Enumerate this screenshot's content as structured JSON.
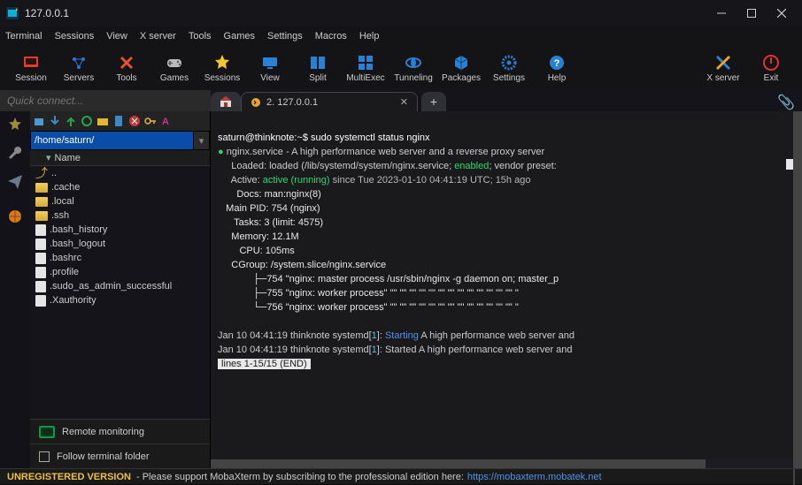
{
  "window": {
    "title": "127.0.0.1"
  },
  "menus": [
    "Terminal",
    "Sessions",
    "View",
    "X server",
    "Tools",
    "Games",
    "Settings",
    "Macros",
    "Help"
  ],
  "toolbar": [
    {
      "label": "Session",
      "color": "#e63a2e"
    },
    {
      "label": "Servers",
      "color": "#2a77d4"
    },
    {
      "label": "Tools",
      "color": "#e6512e"
    },
    {
      "label": "Games",
      "color": "#bbb"
    },
    {
      "label": "Sessions",
      "color": "#f2c72c"
    },
    {
      "label": "View",
      "color": "#2a80d4"
    },
    {
      "label": "Split",
      "color": "#2a80d4"
    },
    {
      "label": "MultiExec",
      "color": "#2a80d4"
    },
    {
      "label": "Tunneling",
      "color": "#2a80d4"
    },
    {
      "label": "Packages",
      "color": "#2a80d4"
    },
    {
      "label": "Settings",
      "color": "#2a80d4"
    },
    {
      "label": "Help",
      "color": "#2a80d4"
    }
  ],
  "toolbar_right": [
    {
      "label": "X server",
      "color": "#e6a52e"
    },
    {
      "label": "Exit",
      "color": "#e6332e"
    }
  ],
  "quick_connect_placeholder": "Quick connect...",
  "active_tab": "2. 127.0.0.1",
  "left": {
    "path": "/home/saturn/",
    "col_header": "Name",
    "files": [
      {
        "type": "up",
        "name": ".."
      },
      {
        "type": "folder",
        "name": ".cache"
      },
      {
        "type": "folder",
        "name": ".local"
      },
      {
        "type": "folder",
        "name": ".ssh"
      },
      {
        "type": "file",
        "name": ".bash_history"
      },
      {
        "type": "file",
        "name": ".bash_logout"
      },
      {
        "type": "file",
        "name": ".bashrc"
      },
      {
        "type": "file",
        "name": ".profile"
      },
      {
        "type": "file",
        "name": ".sudo_as_admin_successful"
      },
      {
        "type": "file",
        "name": ".Xauthority"
      }
    ],
    "remote_monitor": "Remote monitoring",
    "follow": "Follow terminal folder"
  },
  "term": {
    "prompt": "saturn@thinknote:~$ ",
    "command": "sudo systemctl status nginx",
    "l1_a": "nginx.service - A high performance web server and a reverse proxy server",
    "l2_a": "     Loaded: loaded (/lib/systemd/system/nginx.service; ",
    "l2_b": "enabled",
    "l2_c": "; vendor preset: ",
    "l3_a": "     Active: ",
    "l3_b": "active (running)",
    "l3_c": " since Tue 2023-01-10 04:41:19 UTC; 15h ago",
    "l4": "       Docs: man:nginx(8)",
    "l5": "   Main PID: 754 (nginx)",
    "l6": "      Tasks: 3 (limit: 4575)",
    "l7": "     Memory: 12.1M",
    "l8": "        CPU: 105ms",
    "l9": "     CGroup: /system.slice/nginx.service",
    "l10": "             ├─754 \"nginx: master process /usr/sbin/nginx -g daemon on; master_p",
    "l11": "             ├─755 \"nginx: worker process\" \"\" \"\" \"\" \"\" \"\" \"\" \"\" \"\" \"\" \"\" \"\" \"\" \"\" \"",
    "l12": "             └─756 \"nginx: worker process\" \"\" \"\" \"\" \"\" \"\" \"\" \"\" \"\" \"\" \"\" \"\" \"\" \"\" \"",
    "l14a": "Jan 10 04:41:19 thinknote systemd[",
    "l14b": "1",
    "l14c": "]: ",
    "l14d": "Starting",
    "l14e": " A high performance web server and",
    "l15a": "Jan 10 04:41:19 thinknote systemd[",
    "l15b": "1",
    "l15c": "]: Started A high performance web server and ",
    "l16": " lines 1-15/15 (END) "
  },
  "footer": {
    "unreg": "UNREGISTERED VERSION",
    "msg": "-   Please support MobaXterm by subscribing to the professional edition here:",
    "link": "https://mobaxterm.mobatek.net"
  }
}
